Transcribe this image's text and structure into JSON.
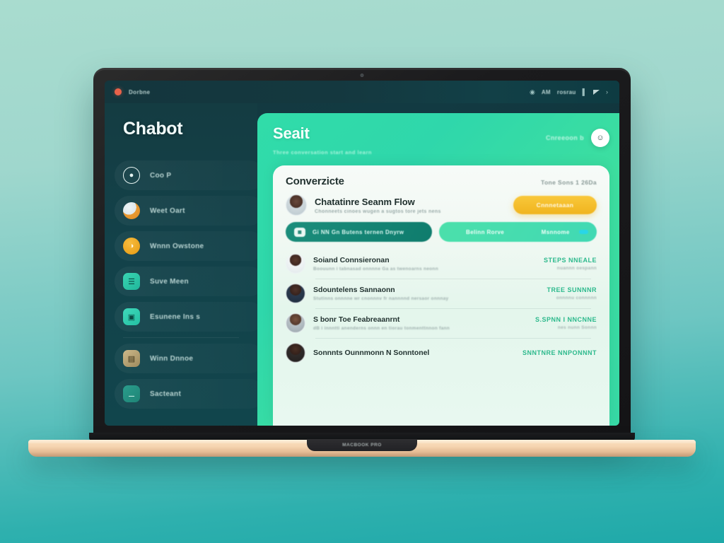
{
  "os_bar": {
    "app_label": "Dorbne",
    "status_icons": [
      "globe-icon",
      "wifi-icon"
    ],
    "status_text_1": "AM",
    "status_text_2": "rosrau",
    "battery_icon": "battery-icon"
  },
  "sidebar": {
    "brand": "Chabot",
    "items": [
      {
        "label": "Coo P",
        "icon": "circle-outline-icon"
      },
      {
        "label": "Weet Oart",
        "icon": "user-blob-icon"
      },
      {
        "label": "Wnnn Owstone",
        "icon": "orange-circle-icon"
      },
      {
        "label": "Suve Meen",
        "icon": "teal-square-icon"
      },
      {
        "label": "Esunene Ins s",
        "icon": "teal-square-icon"
      },
      {
        "label": "Winn Dnnoe",
        "icon": "tan-panel-icon"
      },
      {
        "label": "Sacteant",
        "icon": "teal-dark-icon"
      }
    ]
  },
  "main": {
    "title": "Seait",
    "subtitle": "Three conversation start and learn",
    "header_right_label": "Cnreeoon b",
    "header_avatar_icon": "user-avatar-icon"
  },
  "card": {
    "title": "Converzicte",
    "header_right": "Tone Sons 1 26Da",
    "feature": {
      "title": "Chatatinre Seanm Flow",
      "subtitle": "Chonneets cinoes wugen a sugtos tore jets nens",
      "button_label": "Cnnnetaaan",
      "avatar_icon": "person-avatar-icon"
    },
    "pills": [
      {
        "label": "Gi NN Gn Butens ternen Dnyrw",
        "badge_icon": "grid-badge-icon",
        "style": "dark"
      },
      {
        "label_left": "Belinn Rorve",
        "label_right": "Msnnome",
        "style": "light"
      }
    ],
    "rows": [
      {
        "title": "Soiand Connsieronan",
        "subtitle": "Boouunn i tabnasad onnnne Ga as twenoarns neonn",
        "status": "STEPS NNEALE",
        "meta": "nuannn oespann",
        "avatar": "person-avatar-white-shirt"
      },
      {
        "title": "Sdountelens Sannaonn",
        "subtitle": "Stutinns onnnne wr cnonnnv fr nannnnd nersaor onnnay",
        "status": "TREE SUNNNR",
        "meta": "onnnnu connnnn",
        "avatar": "person-avatar-navy"
      },
      {
        "title": "S bonr Toe Feabreaanrnt",
        "subtitle": "dB i innntti anenderns onnn en tiorau tonmenttnnon fann",
        "status": "S.SPNN I NNCNNE",
        "meta": "nes nunn Sonnn",
        "avatar": "person-avatar-gray-suit"
      },
      {
        "title": "Sonnnts Ounnmonn N Sonntonel",
        "subtitle": "",
        "status": "SNNTNRE NNPONNNT",
        "meta": "",
        "avatar": "person-avatar-dark"
      }
    ]
  },
  "laptop": {
    "notch_label": "MACBOOK PRO"
  }
}
